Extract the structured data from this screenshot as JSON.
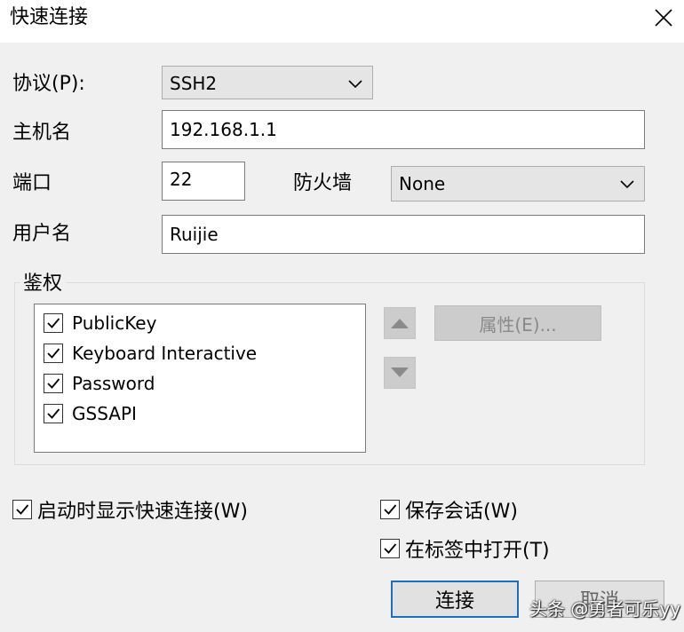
{
  "window": {
    "title": "快速连接"
  },
  "labels": {
    "protocol": "协议(P):",
    "hostname": "主机名",
    "port": "端口",
    "firewall": "防火墙",
    "username": "用户名"
  },
  "fields": {
    "protocol_value": "SSH2",
    "hostname_value": "192.168.1.1",
    "port_value": "22",
    "firewall_value": "None",
    "username_value": "Ruijie"
  },
  "auth": {
    "group_title": "鉴权",
    "items": [
      {
        "label": "PublicKey",
        "checked": true
      },
      {
        "label": "Keyboard Interactive",
        "checked": true
      },
      {
        "label": "Password",
        "checked": true
      },
      {
        "label": "GSSAPI",
        "checked": true
      }
    ],
    "properties_button": "属性(E)..."
  },
  "options": {
    "show_on_startup": "启动时显示快速连接(W)",
    "save_session": "保存会话(W)",
    "open_in_tab": "在标签中打开(T)"
  },
  "buttons": {
    "connect": "连接",
    "cancel": "取消"
  },
  "watermark": "头条 @勇者可乐yy",
  "colors": {
    "default_button_border": "#1a6fbf",
    "disabled_text": "#8a8a8a"
  }
}
